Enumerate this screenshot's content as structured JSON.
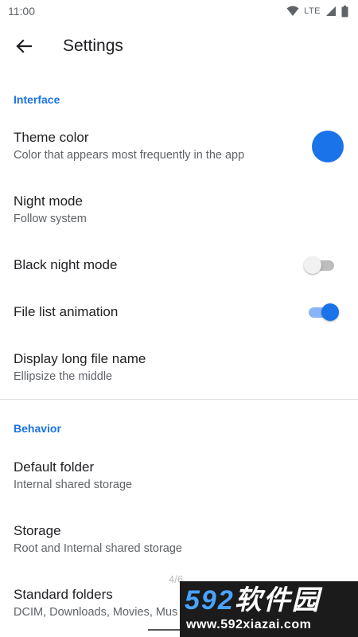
{
  "status_bar": {
    "time": "11:00",
    "network": "LTE",
    "icons": [
      "wifi-icon",
      "signal-icon",
      "battery-icon"
    ]
  },
  "toolbar": {
    "title": "Settings",
    "back_icon": "arrow-back-icon"
  },
  "sections": {
    "interface": {
      "header": "Interface",
      "theme_color": {
        "title": "Theme color",
        "summary": "Color that appears most frequently in the app",
        "swatch_color": "#1a73e8"
      },
      "night_mode": {
        "title": "Night mode",
        "summary": "Follow system"
      },
      "black_night_mode": {
        "title": "Black night mode",
        "enabled": false
      },
      "file_list_animation": {
        "title": "File list animation",
        "enabled": true
      },
      "display_long_file_name": {
        "title": "Display long file name",
        "summary": "Ellipsize the middle"
      }
    },
    "behavior": {
      "header": "Behavior",
      "default_folder": {
        "title": "Default folder",
        "summary": "Internal shared storage"
      },
      "storage": {
        "title": "Storage",
        "summary": "Root and Internal shared storage"
      },
      "standard_folders": {
        "title": "Standard folders",
        "summary": "DCIM, Downloads, Movies, Mus"
      }
    }
  },
  "page_indicator": "4/6",
  "watermark": {
    "logo_digits": "592",
    "logo_text": "软件园",
    "url": "www.592xiazai.com"
  },
  "colors": {
    "accent": "#1a73e8",
    "accent_light": "#8ab4f8",
    "primary_text": "#202124",
    "secondary_text": "#5f6368"
  }
}
